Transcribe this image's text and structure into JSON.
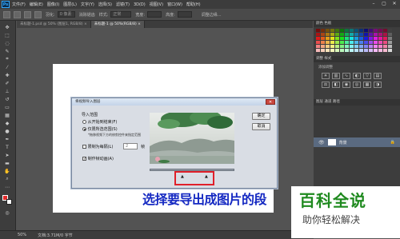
{
  "app": {
    "logo": "Ps",
    "menu": [
      "文件(F)",
      "编辑(E)",
      "图像(I)",
      "图层(L)",
      "文字(Y)",
      "选择(S)",
      "滤镜(T)",
      "3D(D)",
      "视图(V)",
      "窗口(W)",
      "帮助(H)"
    ],
    "window_controls": [
      "–",
      "▢",
      "✕"
    ]
  },
  "options_bar": {
    "feather_label": "羽化:",
    "feather_value": "0 像素",
    "antialias_label": "消除锯齿",
    "style_label": "样式:",
    "style_value": "正常",
    "width_label": "宽度:",
    "height_label": "高度:",
    "refine_label": "调整边缘..."
  },
  "tabs": [
    {
      "label": "未标题-1.psd @ 50% (图层1, RGB/8) ×",
      "active": false
    },
    {
      "label": "未标题-1 @ 50%(RGB/8) ×",
      "active": true
    }
  ],
  "status": {
    "zoom": "50%",
    "doc": "文档:3.71M/0 字节"
  },
  "panels": {
    "swatch_tab": "颜色 色板",
    "adjust_tab": "调整 样式",
    "adjust_add": "添加调整",
    "layers_tab": "图层 通道 路径",
    "layer_name": "背景"
  },
  "dialog": {
    "title": "将视频导入图层",
    "close": "✕",
    "range_label": "导入范围",
    "option_all": "从开始到结束(F)",
    "option_selected": "仅限所选范围(S)",
    "option_hint": "*拖移视频下方的修剪控件来指定范围",
    "limit_label": "限制为每隔(L)",
    "limit_value": "2",
    "limit_unit": "帧",
    "frame_anim_label": "制作帧动画(A)",
    "ok": "确定",
    "cancel": "取消"
  },
  "caption": "选择要导出成图片的段",
  "watermark": {
    "title": "百科全说",
    "subtitle": "助你轻松解决"
  },
  "colors": {
    "ps_dark": "#3c3c3c",
    "canvas_bg": "#535353",
    "caption_blue": "#1529c2",
    "watermark_green": "#1f8a1f",
    "highlight_red": "#e0202a"
  }
}
